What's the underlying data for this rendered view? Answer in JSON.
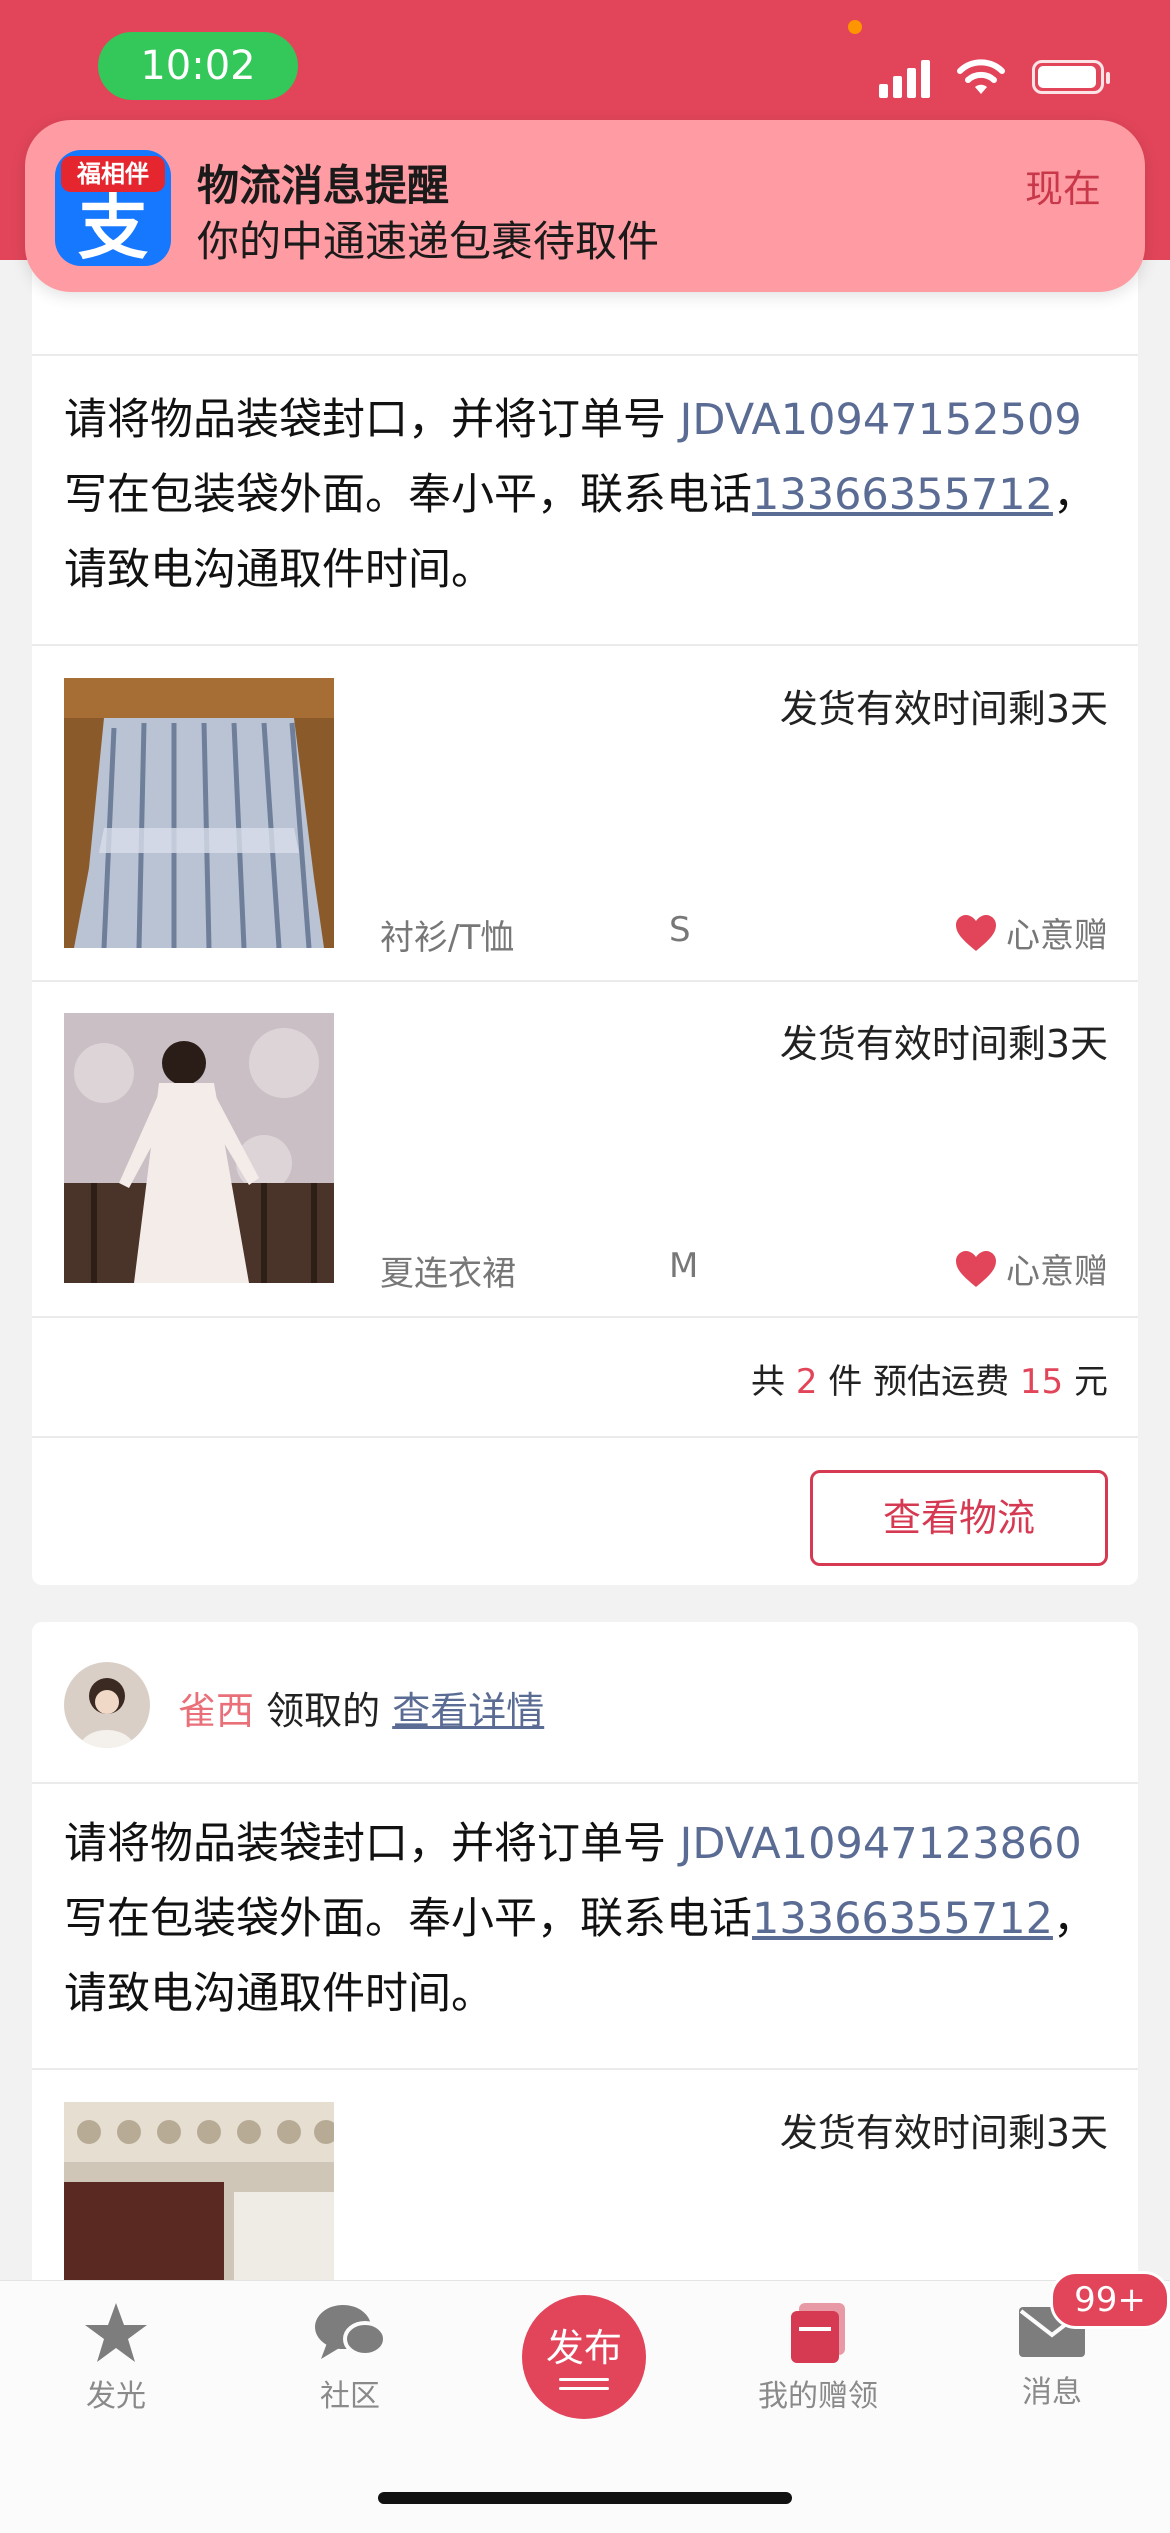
{
  "status_bar": {
    "time": "10:02"
  },
  "notification": {
    "app_badge": "福相伴",
    "app_glyph": "支",
    "title": "物流消息提醒",
    "body": "你的中通速递包裹待取件",
    "time": "现在"
  },
  "order1": {
    "instruction_pre": "请将物品装袋封口，并将订单号 ",
    "order_no": "JDVA10947152509",
    "instruction_mid": " 写在包装袋外面。奉小平，联系电话",
    "phone": "13366355712",
    "instruction_post": "，请致电沟通取件时间。",
    "items": [
      {
        "deadline": "发货有效时间剩3天",
        "category": "衬衫/T恤",
        "size": "S",
        "tag": "心意赠"
      },
      {
        "deadline": "发货有效时间剩3天",
        "category": "夏连衣裙",
        "size": "M",
        "tag": "心意赠"
      }
    ],
    "summary": {
      "count_pre": "共 ",
      "count": "2",
      "count_post": " 件 预估运费 ",
      "fee": "15",
      "fee_post": " 元"
    },
    "logistics_button": "查看物流"
  },
  "order2": {
    "nickname": "雀西",
    "received_text": " 领取的 ",
    "detail_link": "查看详情",
    "instruction_pre": "请将物品装袋封口，并将订单号 ",
    "order_no": "JDVA10947123860",
    "instruction_mid": " 写在包装袋外面。奉小平，联系电话",
    "phone": "13366355712",
    "instruction_post": "，请致电沟通取件时间。",
    "items": [
      {
        "deadline": "发货有效时间剩3天"
      }
    ]
  },
  "tabbar": {
    "tabs": [
      {
        "label": "发光",
        "icon": "star-icon"
      },
      {
        "label": "社区",
        "icon": "chat-icon"
      },
      {
        "label": "发布",
        "icon": "publish-icon"
      },
      {
        "label": "我的赠领",
        "icon": "gift-icon"
      },
      {
        "label": "消息",
        "icon": "mail-icon"
      }
    ],
    "message_badge": "99+"
  },
  "colors": {
    "brand": "#e2455a",
    "link": "#5a6b94",
    "active_tab": "#d63a52"
  }
}
